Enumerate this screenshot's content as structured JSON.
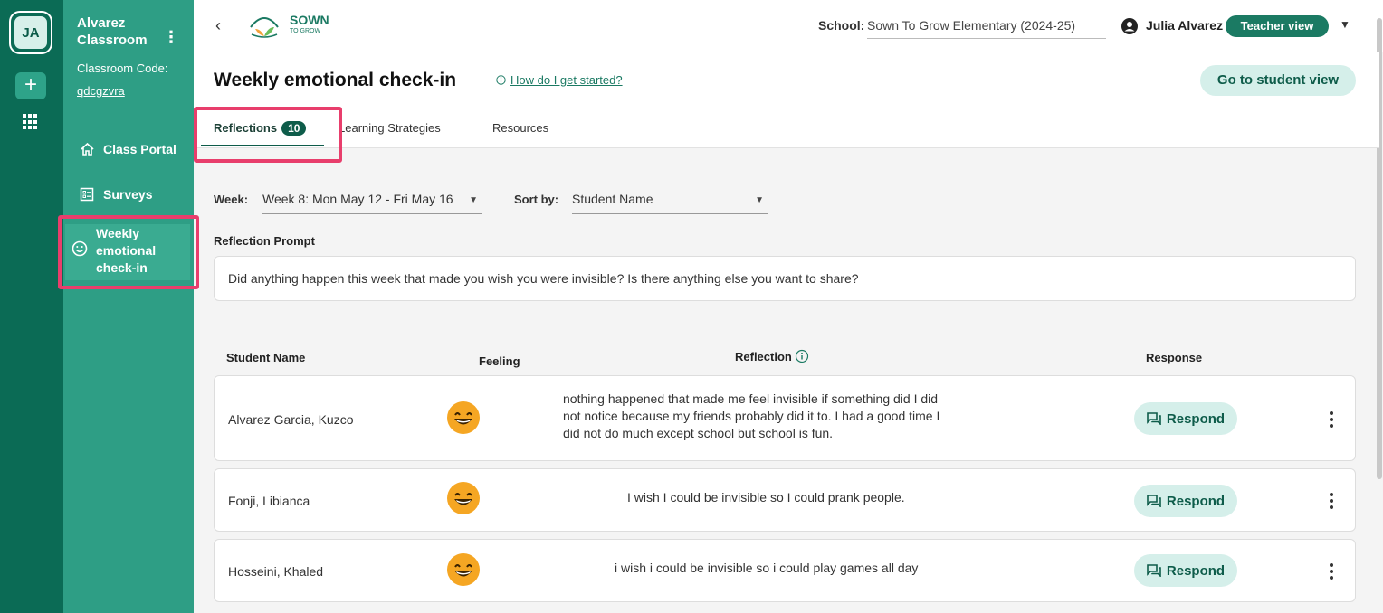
{
  "rail": {
    "avatar_initials": "JA",
    "add_label": "+"
  },
  "sidebar": {
    "class_name": "Alvarez Classroom",
    "code_label": "Classroom Code:",
    "code_value": "qdcgzvra",
    "items": [
      {
        "label": "Class Portal",
        "icon": "home-icon"
      },
      {
        "label": "Surveys",
        "icon": "survey-icon"
      },
      {
        "label": "Weekly emotional check-in",
        "icon": "smiley-icon",
        "active": true
      }
    ]
  },
  "header": {
    "logo_text": "SOWN",
    "logo_subtext": "TO GROW",
    "school_label": "School:",
    "school_value": "Sown To Grow Elementary (2024-25)",
    "user_name": "Julia Alvarez",
    "view_badge": "Teacher view"
  },
  "page": {
    "title": "Weekly emotional check-in",
    "help_link": "How do I get started?",
    "student_view_button": "Go to student view"
  },
  "tabs": [
    {
      "label": "Reflections",
      "badge": "10",
      "active": true
    },
    {
      "label": "Learning Strategies"
    },
    {
      "label": "Resources"
    }
  ],
  "filters": {
    "week_label": "Week:",
    "week_value": "Week 8: Mon May 12 - Fri May 16",
    "sort_label": "Sort by:",
    "sort_value": "Student Name"
  },
  "prompt": {
    "label": "Reflection Prompt",
    "text": "Did anything happen this week that made you wish you were invisible? Is there anything else you want to share?"
  },
  "table": {
    "headers": {
      "name": "Student Name",
      "feeling": "Feeling",
      "reflection": "Reflection",
      "response": "Response"
    },
    "respond_label": "Respond",
    "rows": [
      {
        "name": "Alvarez Garcia, Kuzco",
        "feeling": "grinning-face",
        "reflection_lines": [
          "nothing happened that made me feel invisible if something did I did",
          "not notice because my friends probably did it to. I had a good time I",
          "did not do much except school but school is fun."
        ]
      },
      {
        "name": "Fonji, Libianca",
        "feeling": "grinning-face",
        "reflection": "I wish I could be invisible so I could prank people."
      },
      {
        "name": "Hosseini, Khaled",
        "feeling": "grinning-face",
        "reflection": "i wish i could be invisible so i could play games all day"
      }
    ]
  },
  "colors": {
    "rail": "#0b6b55",
    "sidebar": "#2e9e85",
    "accent": "#0e5c4a",
    "button_bg": "#d5efea",
    "highlight": "#e83e6c"
  }
}
